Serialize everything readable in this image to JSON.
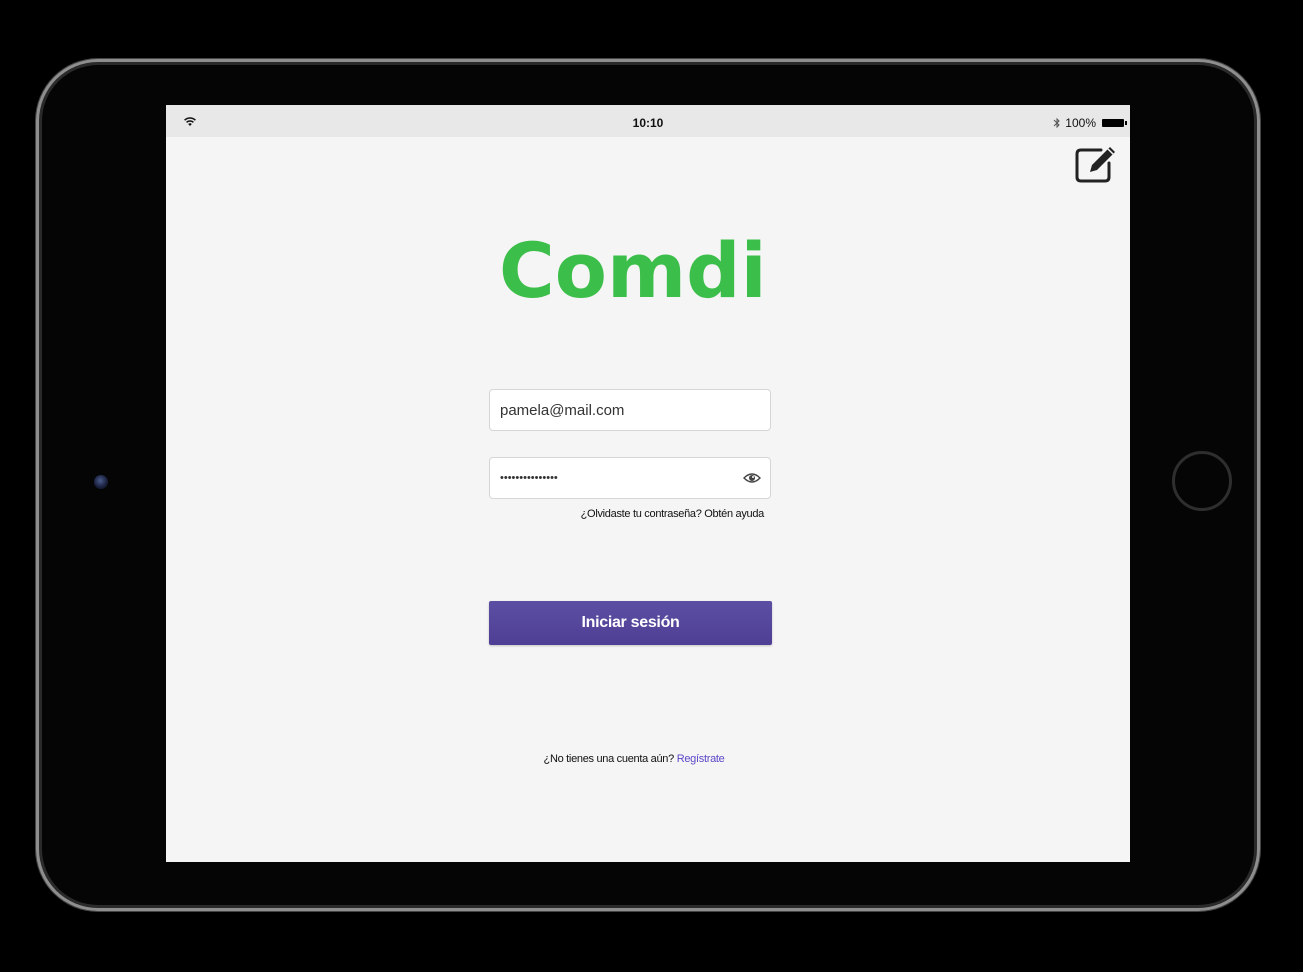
{
  "status_bar": {
    "time": "10:10",
    "battery": "100%",
    "icons": [
      "wifi-icon",
      "bluetooth-icon",
      "battery-icon"
    ]
  },
  "header": {
    "edit_icon": "edit-icon"
  },
  "logo": {
    "text": "Comdi",
    "color": "#3cbe4a"
  },
  "login_form": {
    "email_value": "pamela@mail.com",
    "password_value": "•••••••••••••••",
    "show_password_icon": "eye-icon",
    "forgot_password_text": "¿Olvidaste tu contraseña? Obtén ayuda",
    "submit_label": "Iniciar sesión",
    "submit_color": "#564a9e"
  },
  "signup": {
    "prompt": "¿No tienes una cuenta aún?",
    "link_label": "Regístrate",
    "link_color": "#5b48c8"
  }
}
